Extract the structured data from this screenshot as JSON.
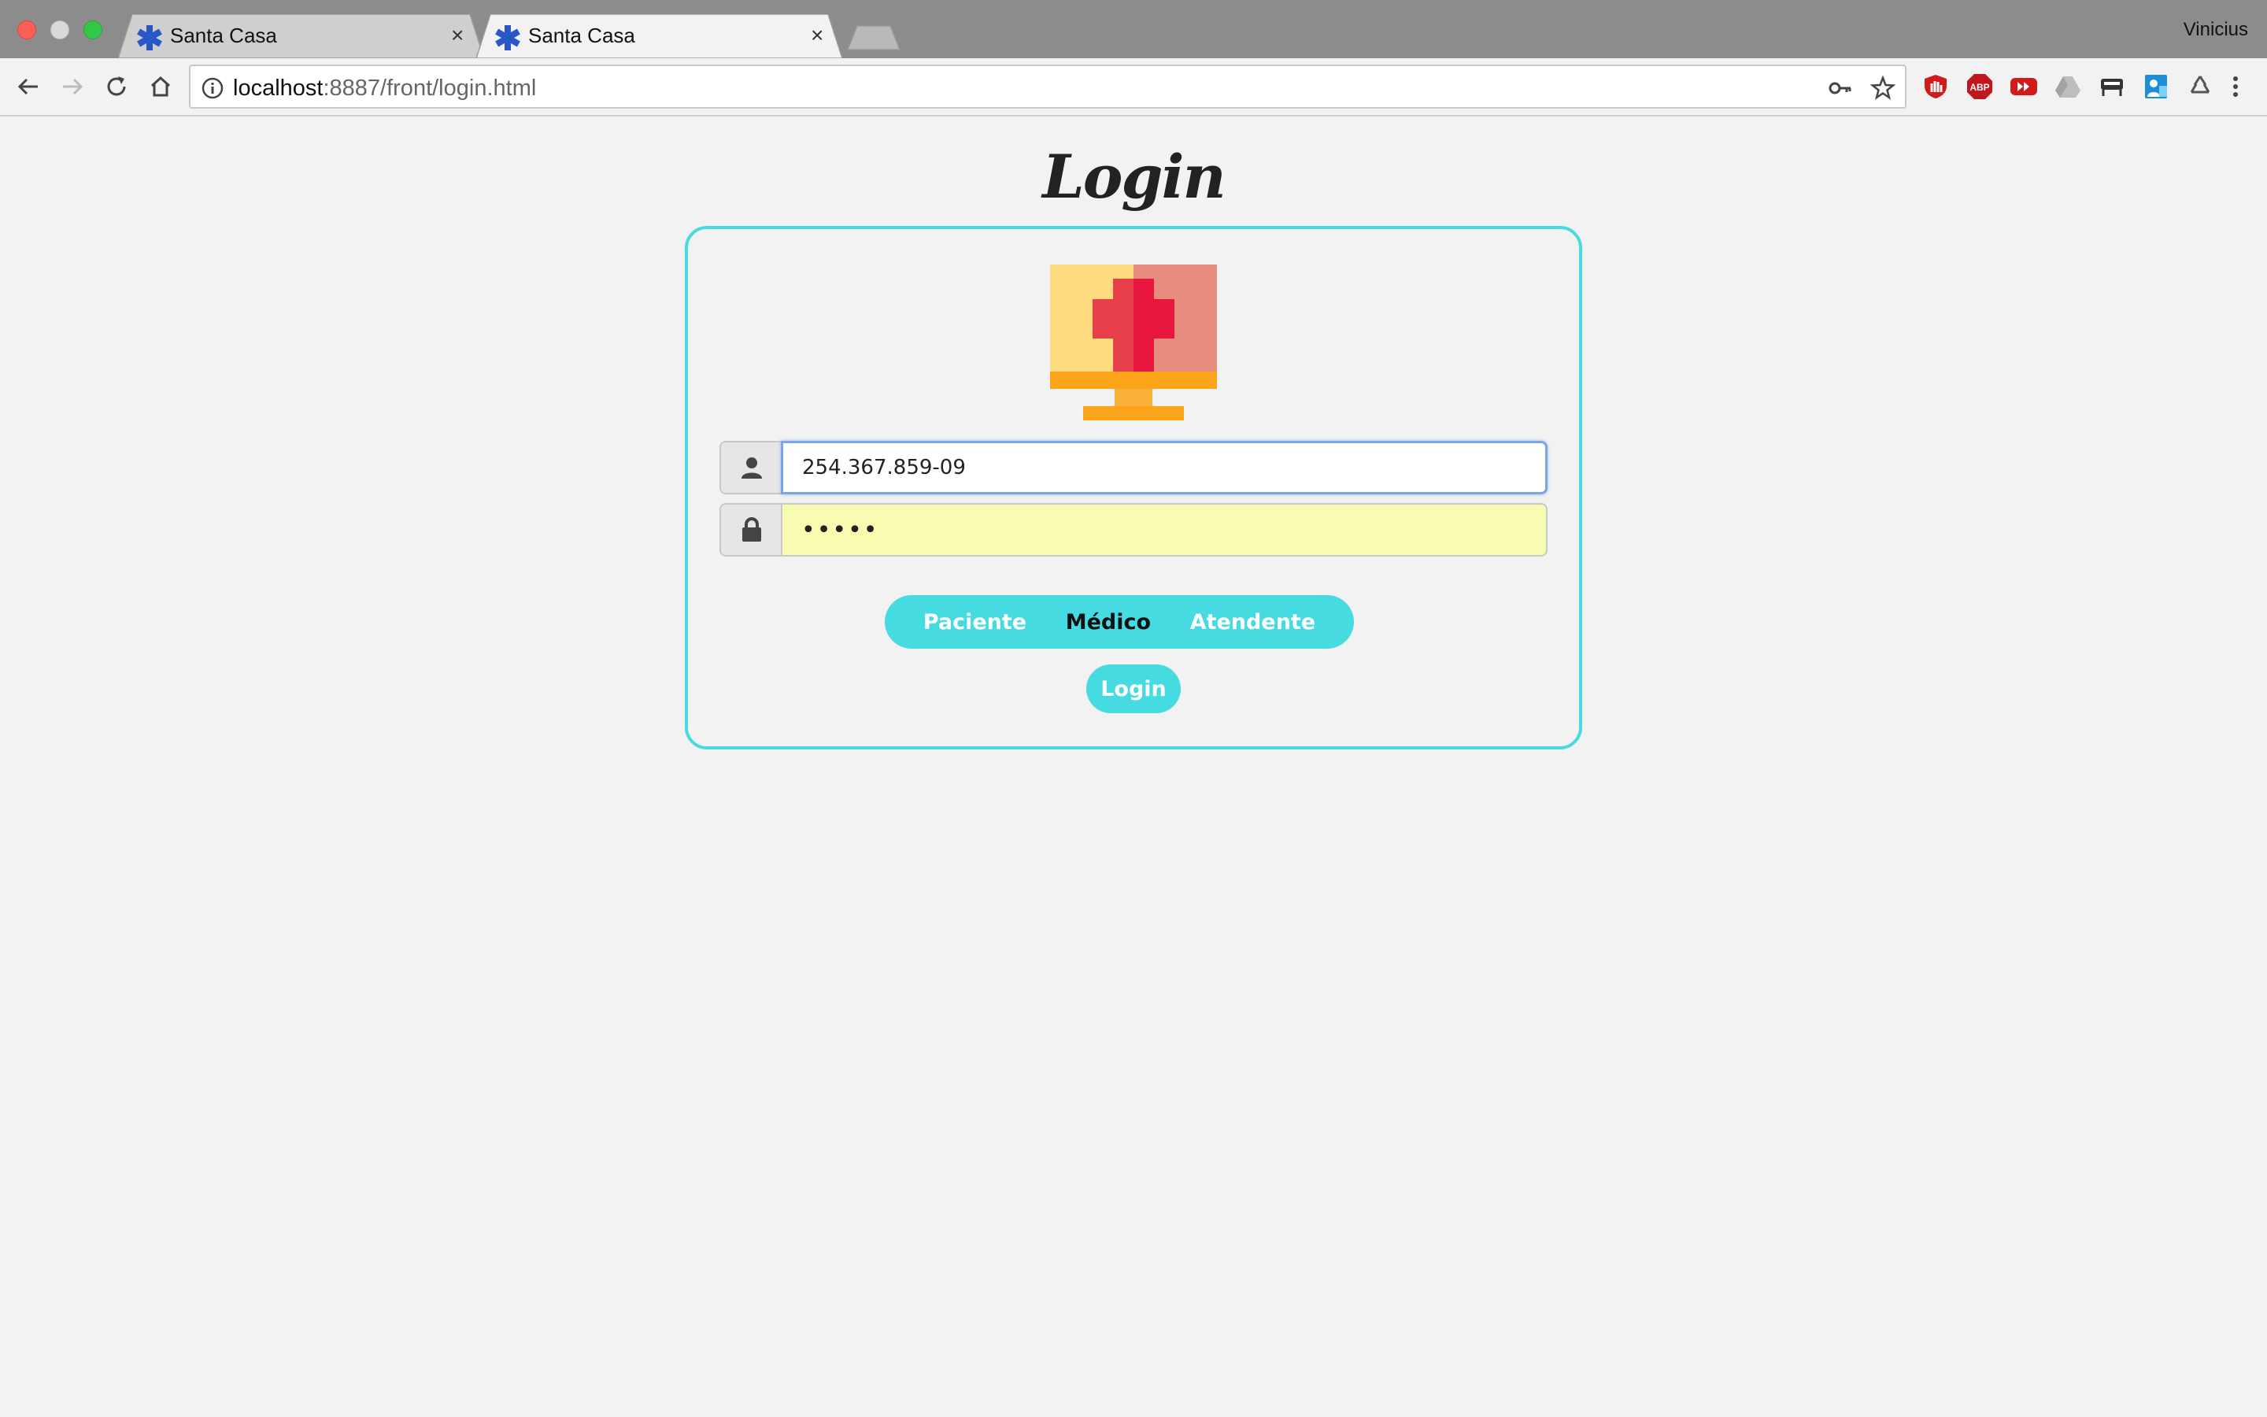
{
  "browser": {
    "tabs": [
      {
        "title": "Santa Casa",
        "active": false
      },
      {
        "title": "Santa Casa",
        "active": true
      }
    ],
    "close_glyph": "×",
    "profile_name": "Vinicius",
    "url_host": "localhost",
    "url_rest": ":8887/front/login.html",
    "extensions": [
      "ublock-icon",
      "adblock-plus-icon",
      "youtube-icon",
      "google-drive-icon",
      "extension-icon",
      "contact-icon",
      "recycle-icon"
    ]
  },
  "page": {
    "title": "Login",
    "username_value": "254.367.859-09",
    "password_value": "•••••",
    "roles": [
      "Paciente",
      "Médico",
      "Atendente"
    ],
    "active_role": "Médico",
    "login_label": "Login"
  },
  "colors": {
    "accent": "#46dbe0",
    "autofill": "#f8fcb0",
    "logo_yellow": "#fddb7e",
    "logo_salmon": "#e88c7d",
    "logo_red": "#e8153e",
    "logo_orange": "#fba41a"
  }
}
